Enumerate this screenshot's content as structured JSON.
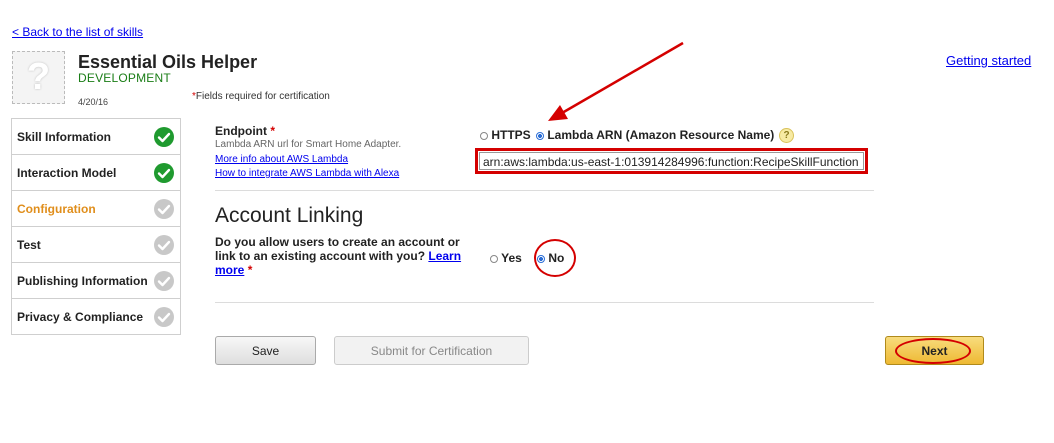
{
  "nav": {
    "back_link": "< Back to the list of skills",
    "getting_started": "Getting started"
  },
  "skill": {
    "thumb_glyph": "?",
    "name": "Essential Oils Helper",
    "status": "DEVELOPMENT",
    "date": "4/20/16"
  },
  "required_note": {
    "star": "*",
    "text": "Fields required for certification"
  },
  "sidebar": {
    "items": [
      {
        "label": "Skill Information",
        "done": true
      },
      {
        "label": "Interaction Model",
        "done": true
      },
      {
        "label": "Configuration",
        "done": false,
        "active": true
      },
      {
        "label": "Test",
        "done": false
      },
      {
        "label": "Publishing Information",
        "done": false
      },
      {
        "label": "Privacy & Compliance",
        "done": false
      }
    ]
  },
  "endpoint": {
    "label": "Endpoint",
    "star": "*",
    "help": "Lambda ARN url for Smart Home Adapter.",
    "link_lambda_info": "More info about AWS Lambda",
    "link_integrate": "How to integrate AWS Lambda with Alexa",
    "option_https": "HTTPS",
    "option_lambda": "Lambda ARN (Amazon Resource Name)",
    "selected": "lambda",
    "help_icon": "?",
    "arn_value": "arn:aws:lambda:us-east-1:013914284996:function:RecipeSkillFunction"
  },
  "account_linking": {
    "heading": "Account Linking",
    "question": "Do you allow users to create an account or link to an existing account with you?",
    "learn_more": "Learn more",
    "star": "*",
    "option_yes": "Yes",
    "option_no": "No",
    "selected": "no"
  },
  "buttons": {
    "save": "Save",
    "submit": "Submit for Certification",
    "next": "Next"
  },
  "colors": {
    "check_done": "#1f9a2f",
    "check_todo": "#c8c8c8",
    "annotation_red": "#d40000",
    "active_nav": "#e08e1b"
  }
}
